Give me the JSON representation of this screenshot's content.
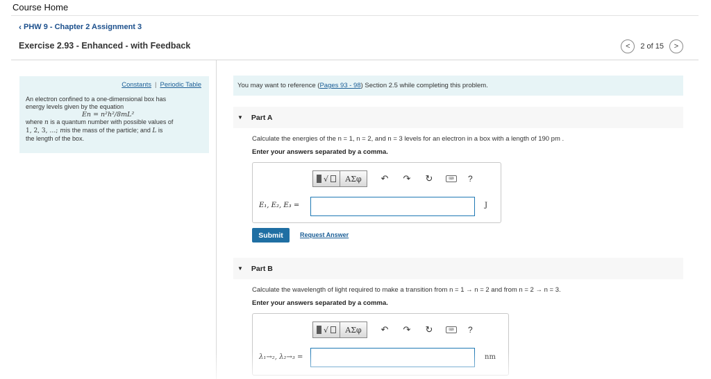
{
  "header": {
    "course_home": "Course Home",
    "breadcrumb": "PHW 9 - Chapter 2 Assignment 3",
    "exercise_title": "Exercise 2.93 - Enhanced - with Feedback",
    "pager_text": "2 of 15"
  },
  "sidebar": {
    "link_constants": "Constants",
    "link_separator": "|",
    "link_periodic": "Periodic Table",
    "line1": "An electron confined to a one-dimensional box has",
    "line2": "energy levels given by the equation",
    "equation": "En = n²h²/8mL²",
    "line3_pre": "where ",
    "line3_var": "n",
    "line3_post": " is a quantum number with possible values of",
    "line4_vals": "1, 2, 3, …;",
    "line4_var": " m",
    "line4_post": "is the mass of the particle; and ",
    "line4_var2": "L",
    "line4_end": " is",
    "line5": "the length of the box."
  },
  "reference": {
    "pre": "You may want to reference (",
    "link": "Pages 93 - 98",
    "post": ") Section 2.5 while completing this problem."
  },
  "part_a": {
    "title": "Part A",
    "question": "Calculate the energies of the n = 1, n = 2, and n = 3 levels for an electron in a box with a length of 190 pm .",
    "instruction": "Enter your answers separated by a comma.",
    "var_label": "E₁, E₂, E₃ =",
    "unit": "J",
    "submit": "Submit",
    "request": "Request Answer"
  },
  "part_b": {
    "title": "Part B",
    "question": "Calculate the wavelength of light required to make a transition from n = 1 → n = 2 and from n = 2 → n = 3.",
    "instruction": "Enter your answers separated by a comma.",
    "var_label": "λ₁→₂, λ₂→₃ =",
    "unit": "nm"
  },
  "toolbar": {
    "templates_label": "√",
    "greek_label": "ΑΣφ",
    "undo": "↶",
    "redo": "↷",
    "reset": "↻",
    "keyboard": "▭",
    "help": "?"
  },
  "icons": {
    "back": "chevron-left-icon",
    "prev": "chevron-left-icon",
    "next": "chevron-right-icon"
  },
  "colors": {
    "link": "#1b5e96",
    "accent": "#1f6fa3",
    "panel_bg": "#e7f4f6",
    "input_border": "#1e78b4"
  }
}
